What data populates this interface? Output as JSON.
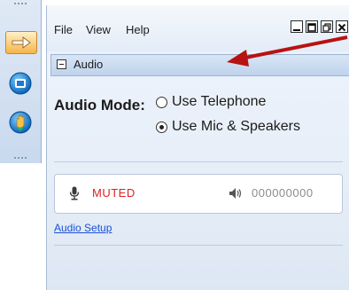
{
  "menu": {
    "file": "File",
    "view": "View",
    "help": "Help"
  },
  "section": {
    "title": "Audio"
  },
  "audio": {
    "mode_label": "Audio Mode:",
    "options": [
      {
        "label": "Use Telephone",
        "selected": false
      },
      {
        "label": "Use Mic & Speakers",
        "selected": true
      }
    ],
    "status": "MUTED",
    "phone_number": "000000000",
    "setup_link": "Audio Setup"
  },
  "colors": {
    "muted": "#e02020",
    "link": "#1a4fd6",
    "arrow_annotation": "#b81212"
  },
  "icons": {
    "sidebar": [
      "arrow-icon",
      "stop-icon",
      "raise-hand-icon"
    ],
    "window": [
      "minimize-icon",
      "restore-icon",
      "popout-icon",
      "close-icon"
    ]
  }
}
